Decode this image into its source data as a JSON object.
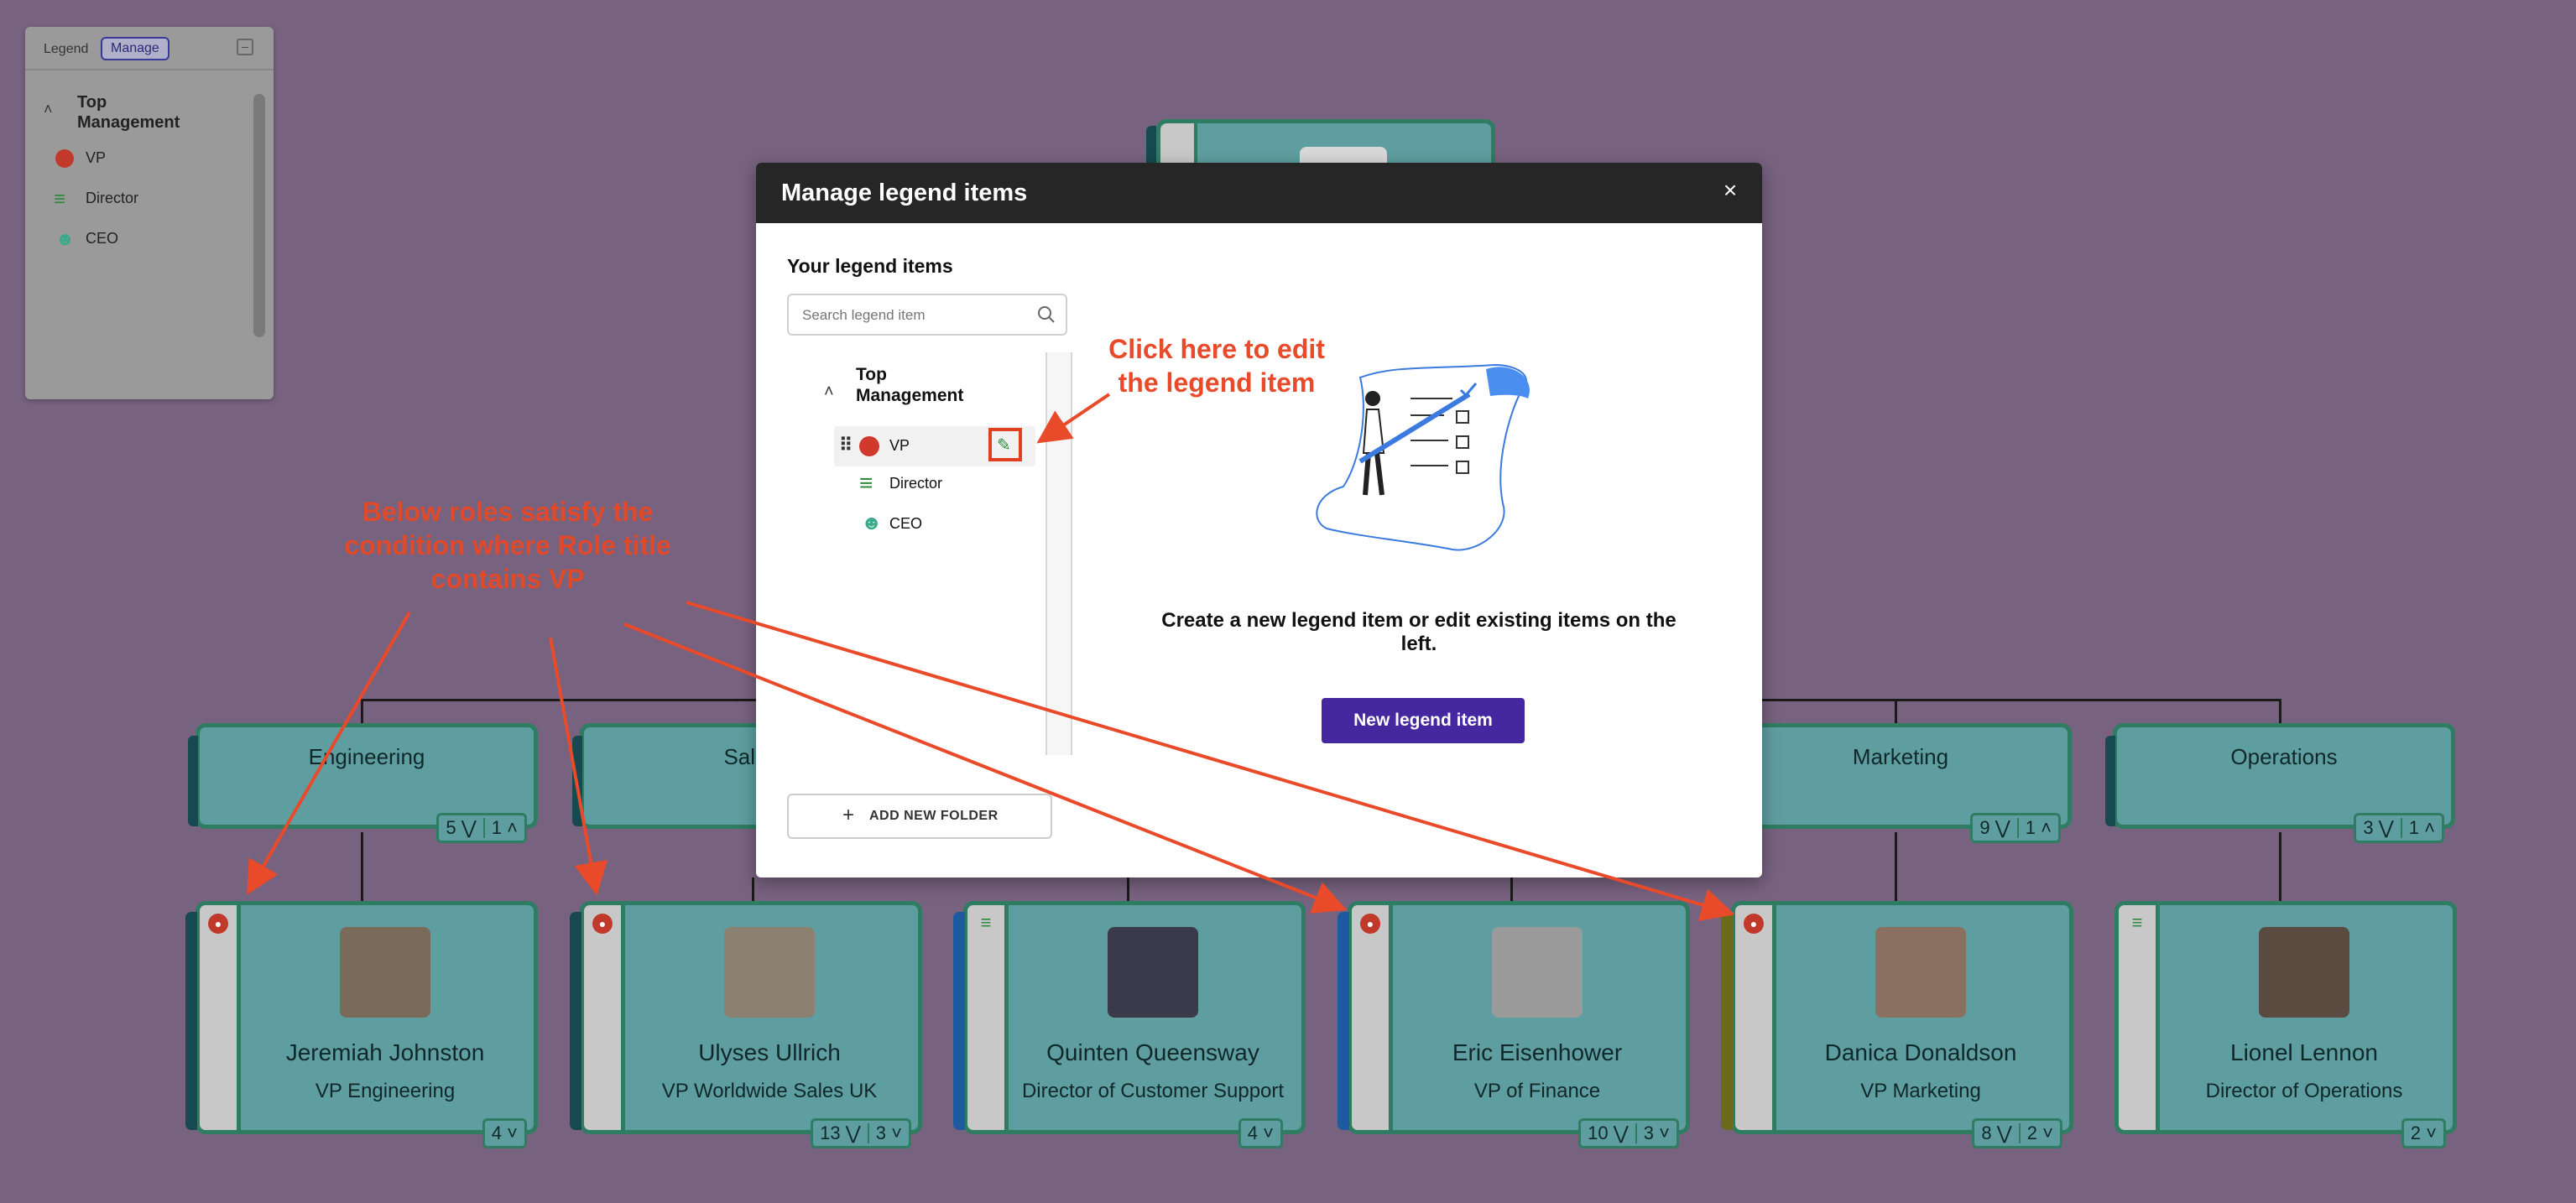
{
  "legend_panel": {
    "title": "Legend",
    "manage_label": "Manage",
    "folder": "Top Management",
    "items": [
      {
        "label": "VP",
        "icon": "user-circle-icon",
        "color": "#c0392b"
      },
      {
        "label": "Director",
        "icon": "list-sort-icon",
        "color": "#2e8b3e"
      },
      {
        "label": "CEO",
        "icon": "person-icon",
        "color": "#3aaa8a"
      }
    ]
  },
  "modal": {
    "title": "Manage legend items",
    "section_title": "Your legend items",
    "search_placeholder": "Search legend item",
    "folder": "Top Management",
    "items": [
      {
        "label": "VP",
        "icon": "user-circle-icon"
      },
      {
        "label": "Director",
        "icon": "list-sort-icon"
      },
      {
        "label": "CEO",
        "icon": "person-icon"
      }
    ],
    "add_folder_label": "ADD NEW FOLDER",
    "empty_message": "Create a new legend item or edit existing items on the left.",
    "new_item_label": "New legend item",
    "accent": "#4527a0"
  },
  "annotations": {
    "edit_hint": "Click here to edit the legend item",
    "roles_hint": "Below roles satisfy the condition where Role title contains VP",
    "color": "#e84a2a"
  },
  "departments": [
    {
      "name": "Engineering",
      "down": "5",
      "up": "1"
    },
    {
      "name": "Sales",
      "down": "",
      "up": ""
    },
    {
      "name": "Marketing",
      "down": "9",
      "up": "1"
    },
    {
      "name": "Operations",
      "down": "3",
      "up": "1"
    }
  ],
  "people": [
    {
      "name": "Jeremiah Johnston",
      "role": "VP Engineering",
      "badge": "vp",
      "count1": "4",
      "count2": ""
    },
    {
      "name": "Ulyses Ullrich",
      "role": "VP Worldwide Sales UK",
      "badge": "vp",
      "count1": "13",
      "count2": "3"
    },
    {
      "name": "Quinten Queensway",
      "role": "Director of Customer Support",
      "badge": "director",
      "count1": "4",
      "count2": ""
    },
    {
      "name": "Eric Eisenhower",
      "role": "VP of Finance",
      "badge": "vp",
      "count1": "10",
      "count2": "3"
    },
    {
      "name": "Danica Donaldson",
      "role": "VP Marketing",
      "badge": "vp",
      "count1": "8",
      "count2": "2"
    },
    {
      "name": "Lionel Lennon",
      "role": "Director of Operations",
      "badge": "director",
      "count1": "2",
      "count2": ""
    }
  ]
}
